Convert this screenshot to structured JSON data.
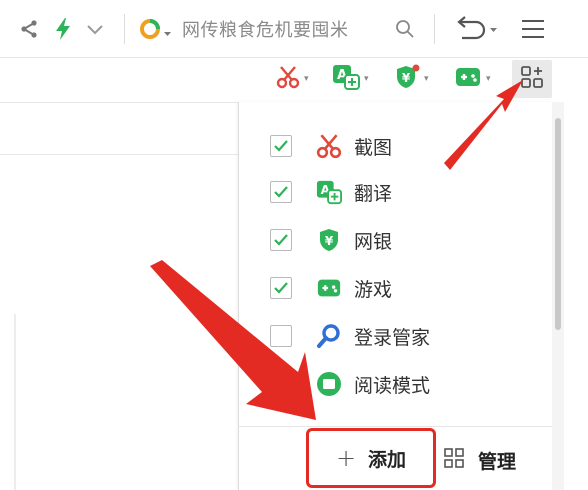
{
  "toolbar": {
    "search_text": "网传粮食危机要囤米",
    "icons": [
      "share-icon",
      "lightning-icon",
      "chevron-down-icon",
      "search-engine-icon",
      "search-icon",
      "undo-icon",
      "menu-icon"
    ]
  },
  "extensions": {
    "icons": [
      "scissors-icon",
      "translate-icon",
      "bank-shield-icon",
      "gamepad-icon",
      "extension-manage-icon"
    ],
    "caret": "▾"
  },
  "menu": {
    "items": [
      {
        "label": "截图",
        "checked": true,
        "icon": "scissors-icon"
      },
      {
        "label": "翻译",
        "checked": true,
        "icon": "translate-icon"
      },
      {
        "label": "网银",
        "checked": true,
        "icon": "bank-shield-icon"
      },
      {
        "label": "游戏",
        "checked": true,
        "icon": "gamepad-icon"
      },
      {
        "label": "登录管家",
        "checked": false,
        "icon": "key-search-icon"
      },
      {
        "label": "阅读模式",
        "checked": false,
        "icon": "reading-mode-icon"
      }
    ],
    "add_label": "添加",
    "add_symbol": "+",
    "manage_label": "管理"
  },
  "colors": {
    "accent_green": "#2fb35a",
    "scissors_red": "#e04a3c",
    "highlight_red": "#e32b23",
    "search_blue": "#2f6fd6"
  }
}
